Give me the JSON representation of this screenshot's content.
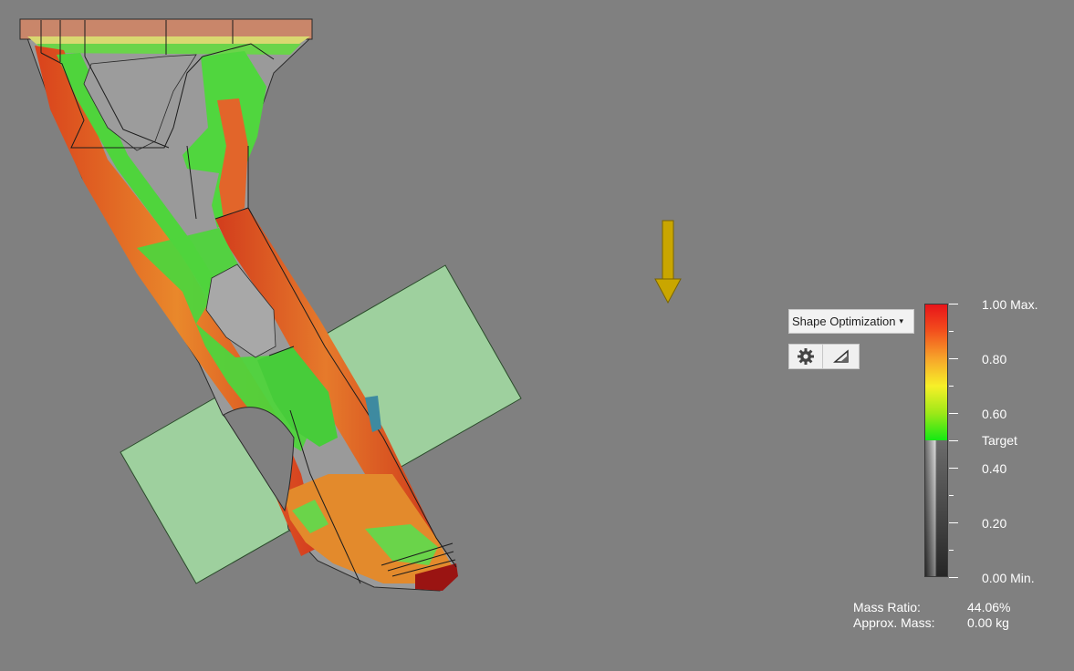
{
  "toolbar": {
    "result_type": "Shape Optimization",
    "dropdown_caret": "▾",
    "settings_icon": "gear-icon",
    "display_icon": "triangle-ruler-icon"
  },
  "legend": {
    "labels": {
      "max": "1.00 Max.",
      "v080": "0.80",
      "v060": "0.60",
      "target": "Target",
      "v040": "0.40",
      "v020": "0.20",
      "min": "0.00 Min."
    },
    "colors": {
      "max": "#e8141a",
      "mid": "#f7f028",
      "target": "#14e814",
      "removed": "#a0a0a0"
    }
  },
  "stats": {
    "mass_ratio_label": "Mass Ratio:",
    "mass_ratio_value": "44.06%",
    "approx_mass_label": "Approx. Mass:",
    "approx_mass_value": "0.00 kg"
  },
  "viewport": {
    "background": "#808080",
    "load_arrow_color": "#c9a600",
    "symmetry_plane_color": "#9fd49f"
  }
}
